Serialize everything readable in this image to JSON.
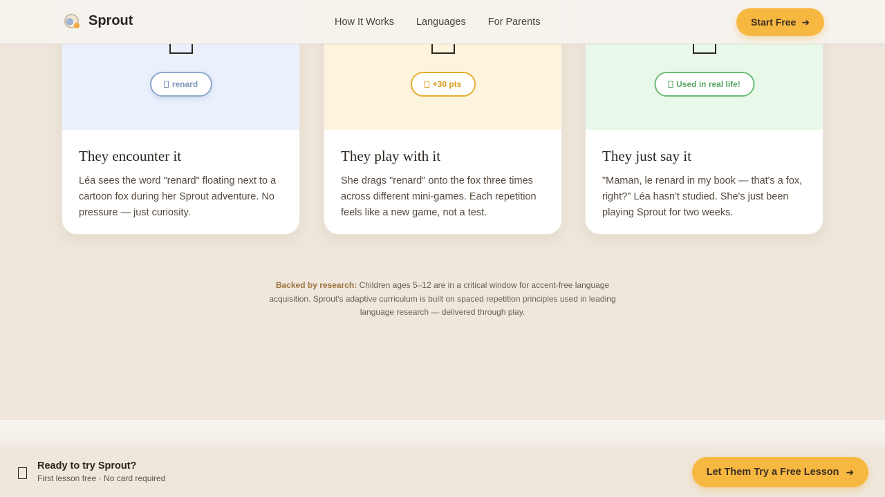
{
  "nav": {
    "brand": "Sprout",
    "links": [
      "How It Works",
      "Languages",
      "For Parents"
    ],
    "cta_label": "Start Free"
  },
  "cards": [
    {
      "badge": "renard",
      "title": "They encounter it",
      "text": "Léa sees the word \"renard\" floating next to a cartoon fox during her Sprout adventure. No pressure — just curiosity."
    },
    {
      "badge": "+30 pts",
      "title": "They play with it",
      "text": "She drags \"renard\" onto the fox three times across different mini-games. Each repetition feels like a new game, not a test."
    },
    {
      "badge": "Used in real life!",
      "title": "They just say it",
      "text": "\"Maman, le renard in my book — that's a fox, right?\" Léa hasn't studied. She's just been playing Sprout for two weeks."
    }
  ],
  "research": {
    "label": "Backed by research:",
    "text": " Children ages 5–12 are in a critical window for accent-free language acquisition. Sprout's adaptive curriculum is built on spaced repetition principles used in leading language research — delivered through play."
  },
  "sticky": {
    "title": "Ready to try Sprout?",
    "subtitle": "First lesson free · No card required",
    "cta_label": "Let Them Try a Free Lesson"
  },
  "colors": {
    "accent": "#f7b842",
    "background": "#efe7dc",
    "badge_blue": "#8da7cc",
    "badge_gold": "#e6ad2e",
    "badge_green": "#6dbb78"
  }
}
